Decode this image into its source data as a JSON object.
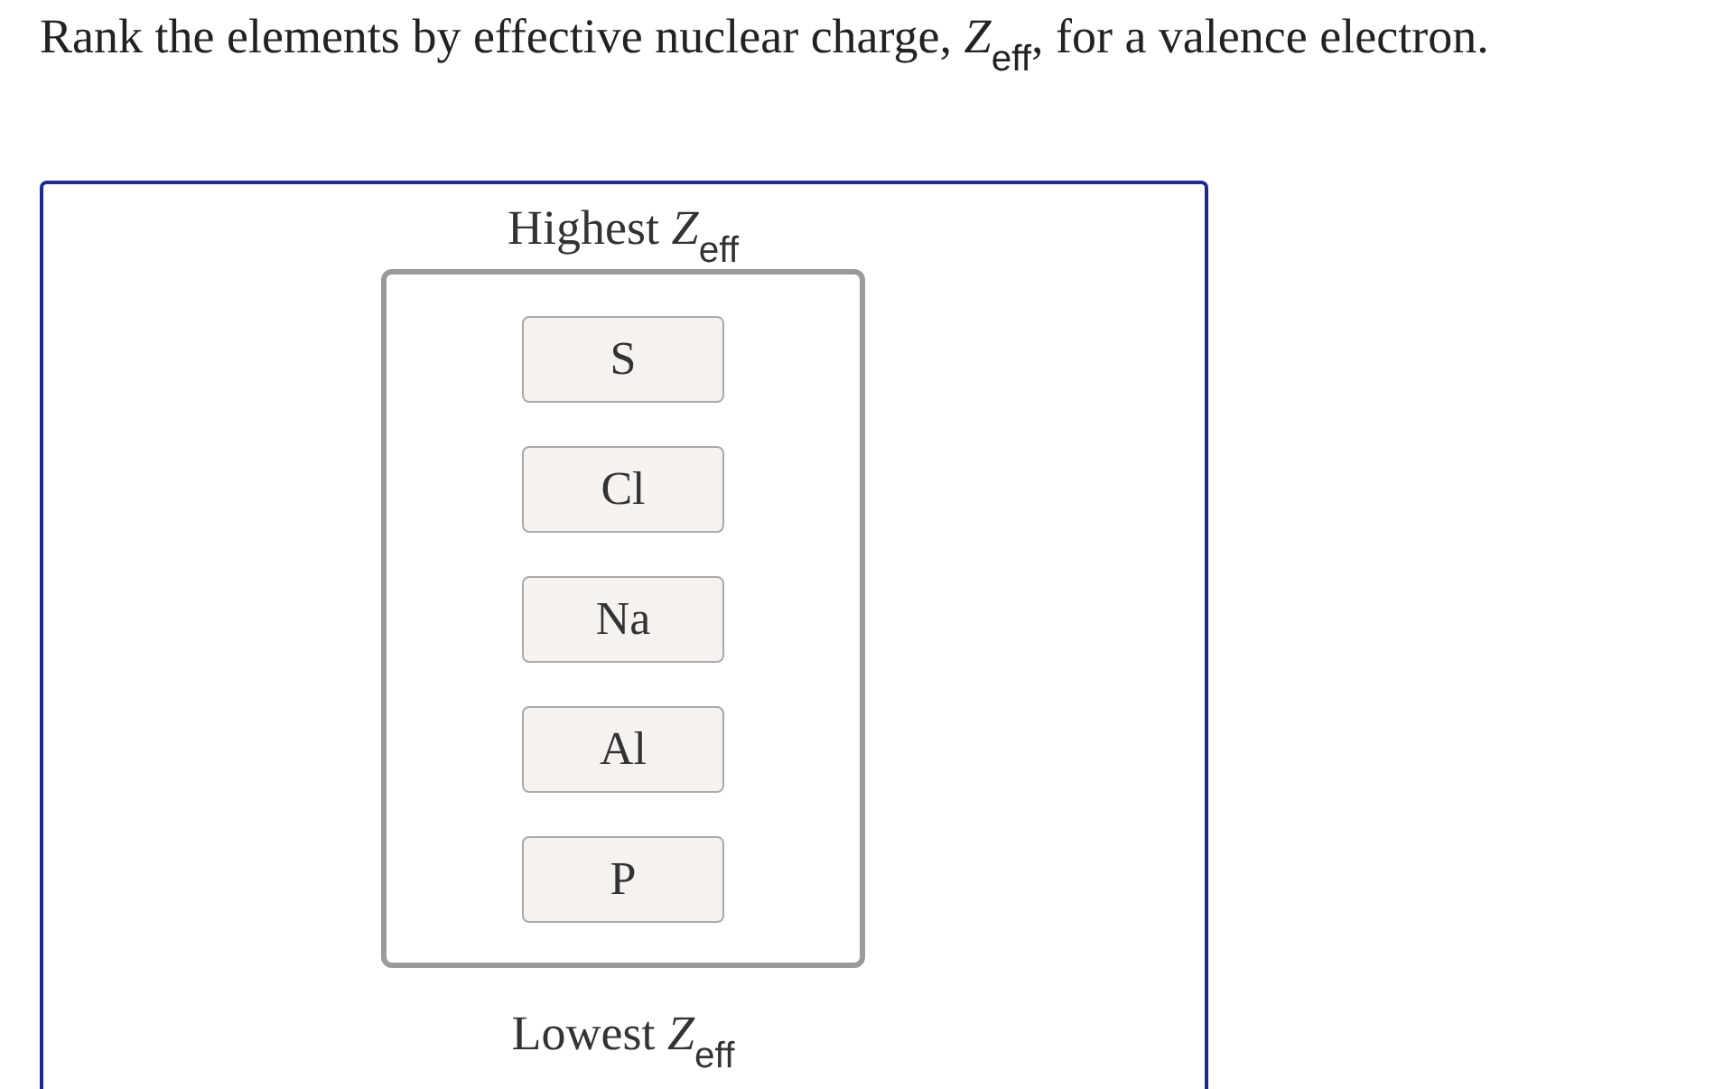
{
  "question": "Rank the elements by effective nuclear charge, *Z*$_{eff}$, for a valence electron.",
  "ranking": {
    "top_label": "Highest *Z*$_{eff}$",
    "items": [
      "S",
      "Cl",
      "Na",
      "Al",
      "P"
    ],
    "bottom_label": "Lowest *Z*$_{eff}$"
  }
}
